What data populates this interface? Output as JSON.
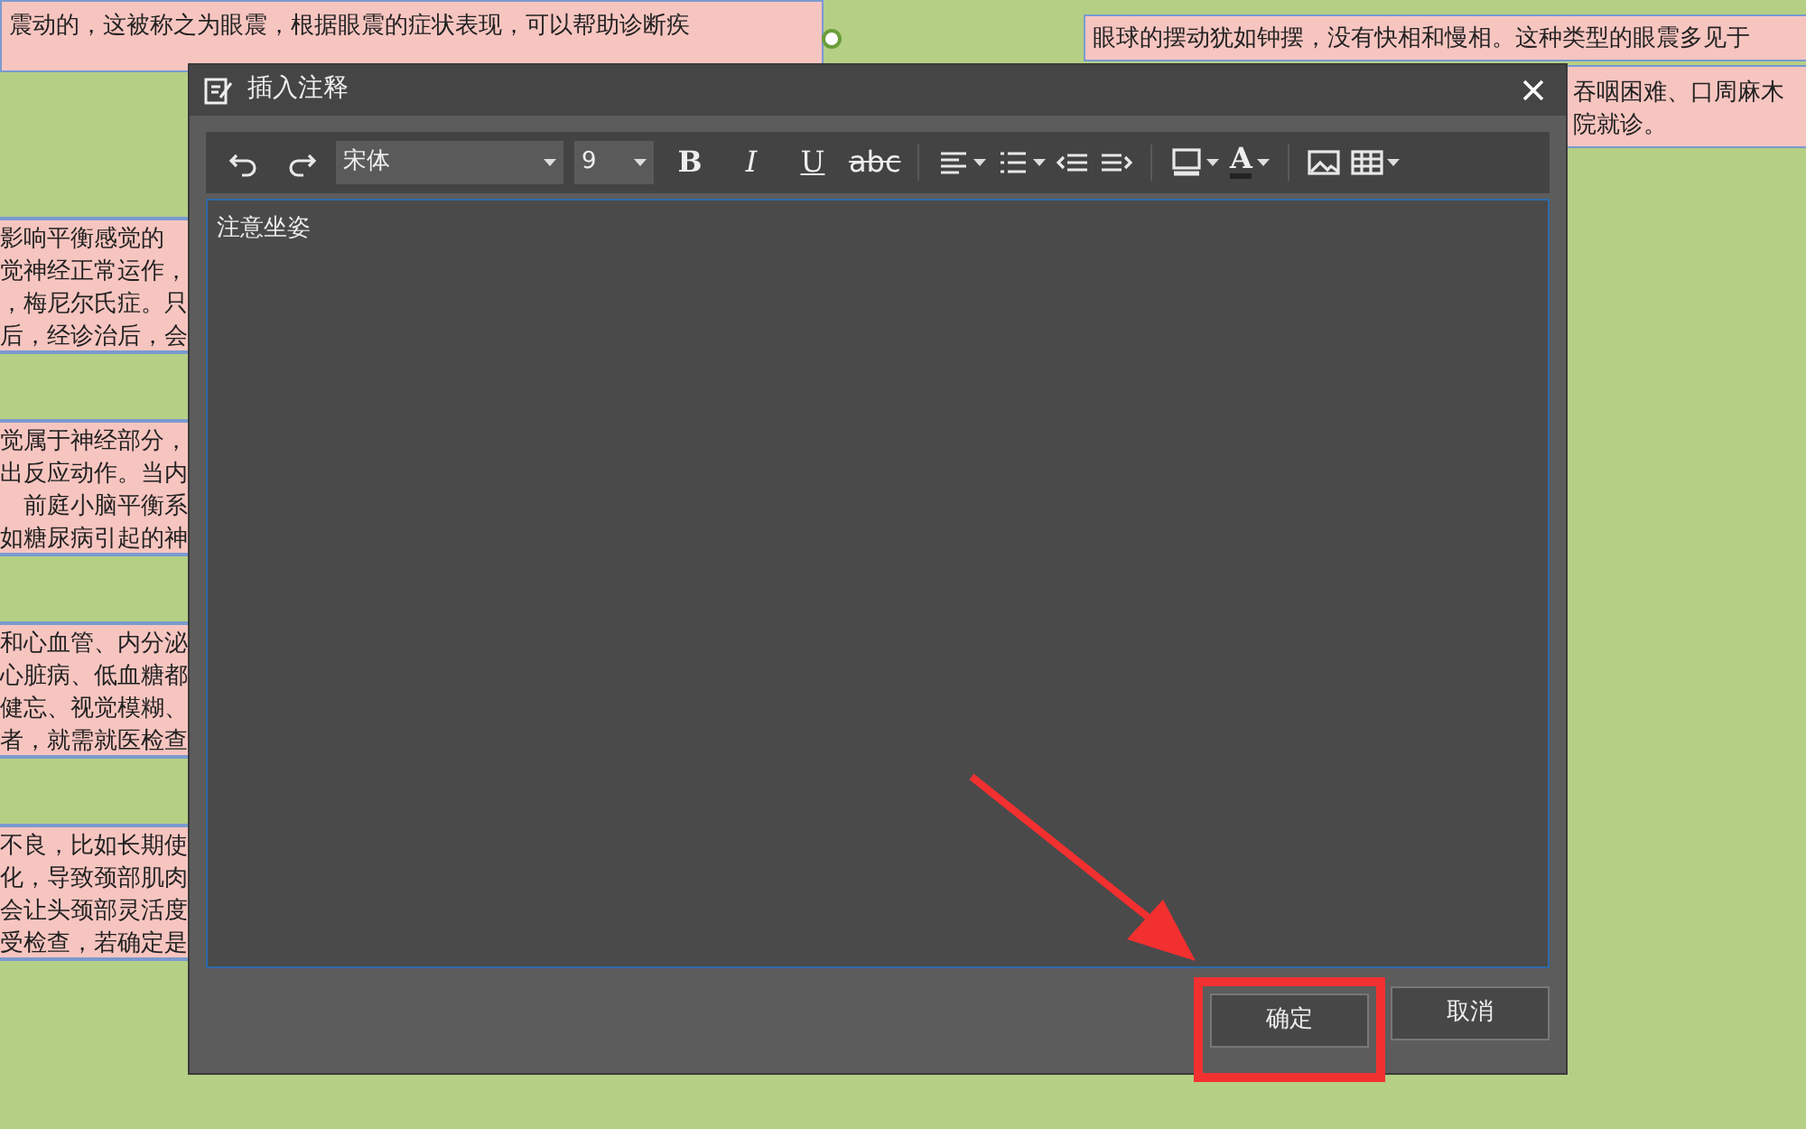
{
  "background_nodes": {
    "top_left": [
      "震动的，这被称之为眼震，根据眼震的症状表现，可以帮助诊断疾"
    ],
    "top_right": [
      "眼球的摆动犹如钟摆，没有快相和慢相。这种类型的眼震多见于"
    ],
    "right": [
      "吞咽困难、口周麻木",
      "院就诊。"
    ],
    "left": [
      [
        "影响平衡感觉的",
        "觉神经正常运作，",
        "，梅尼尔氏症。只",
        "后，经诊治后，会"
      ],
      [
        "觉属于神经部分，",
        "出反应动作。当内",
        "　前庭小脑平衡系",
        "如糖尿病引起的神"
      ],
      [
        "和心血管、内分泌",
        "心脏病、低血糖都",
        "健忘、视觉模糊、",
        "者，就需就医检查"
      ],
      [
        "不良，比如长期使",
        "化，导致颈部肌肉",
        "会让头颈部灵活度",
        "受检查，若确定是"
      ]
    ]
  },
  "dialog": {
    "title": "插入注释",
    "toolbar": {
      "font": "宋体",
      "size": "9",
      "format_buttons": [
        "B",
        "I",
        "U",
        "abc"
      ],
      "color_button": "A"
    },
    "content": "注意坐姿",
    "buttons": [
      {
        "label": "确定",
        "highlighted": true
      },
      {
        "label": "取消",
        "highlighted": false
      }
    ]
  }
}
